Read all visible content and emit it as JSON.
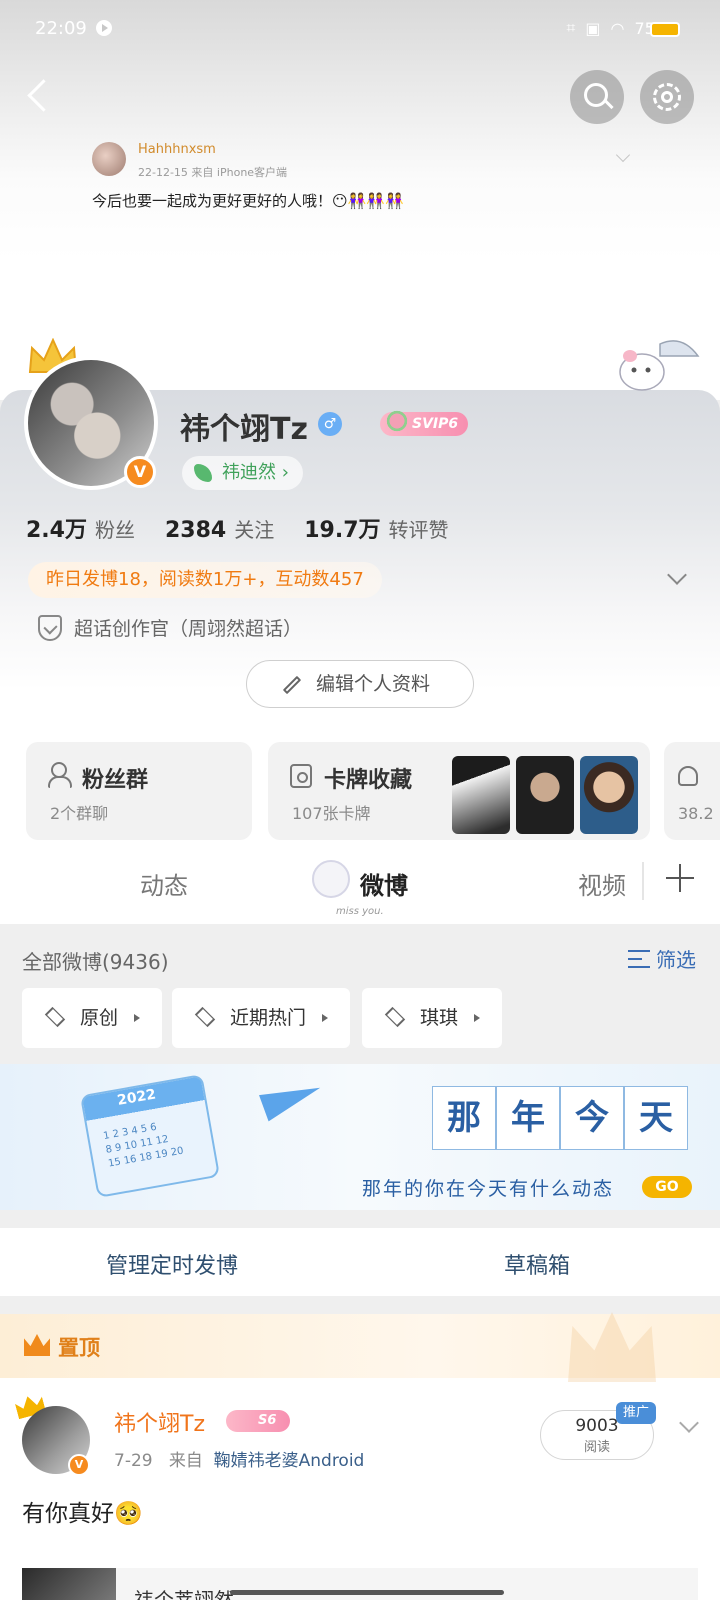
{
  "status_bar": {
    "time": "22:09",
    "icons": [
      "play-icon",
      "nfc-icon",
      "sim-icon",
      "wifi-icon"
    ],
    "battery": "75%"
  },
  "header": {
    "back_icon": "back-arrow-icon",
    "search_icon": "search-icon",
    "settings_icon": "gear-icon"
  },
  "feature_post": {
    "author": "Hahhhnxsm",
    "meta": "22-12-15 来自 iPhone客户端",
    "text": "今后也要一起成为更好更好的人哦！😶👭👭👭"
  },
  "profile": {
    "username": "祎个翊Tz",
    "gender": "♂",
    "svip": "SVIP6",
    "verified": "V",
    "super_topic_tag": "祎迪然 ›",
    "stats": [
      {
        "value": "2.4万",
        "label": "粉丝"
      },
      {
        "value": "2384",
        "label": "关注"
      },
      {
        "value": "19.7万",
        "label": "转评赞"
      }
    ],
    "daily_stats": "昨日发博18，阅读数1万+，互动数457",
    "creator_title": "超话创作官（周翊然超话）",
    "edit_button": "编辑个人资料"
  },
  "cards": {
    "fans_group": {
      "title": "粉丝群",
      "sub": "2个群聊"
    },
    "collection": {
      "title": "卡牌收藏",
      "sub": "107张卡牌"
    },
    "extra": {
      "sub": "38.2"
    }
  },
  "tabs": [
    {
      "label": "动态"
    },
    {
      "label": "微博",
      "mascot_text": "miss you."
    },
    {
      "label": "视频"
    }
  ],
  "filter": {
    "all_count": "全部微博(9436)",
    "filter_label": "筛选",
    "chips": [
      "原创",
      "近期热门",
      "琪琪"
    ]
  },
  "banner": {
    "calendar_year": "2022",
    "calendar_numbers": "1 2 3 4 5 6\n8 9 10 11 12\n15 16 18 19 20",
    "title_chars": [
      "那",
      "年",
      "今",
      "天"
    ],
    "subtitle": "那年的你在今天有什么动态",
    "go": "GO"
  },
  "schedule_bar": {
    "scheduled": "管理定时发博",
    "drafts": "草稿箱"
  },
  "pinned": {
    "label": "置顶",
    "post": {
      "author": "祎个翊Tz",
      "level": "S6",
      "verified": "V",
      "date": "7-29",
      "source_prefix": "来自",
      "source": "鞠婧祎老婆Android",
      "reads": "9003",
      "reads_label": "阅读",
      "promo": "推广",
      "text": "有你真好🥺",
      "embedded_text": "祎个莘翊然"
    }
  }
}
